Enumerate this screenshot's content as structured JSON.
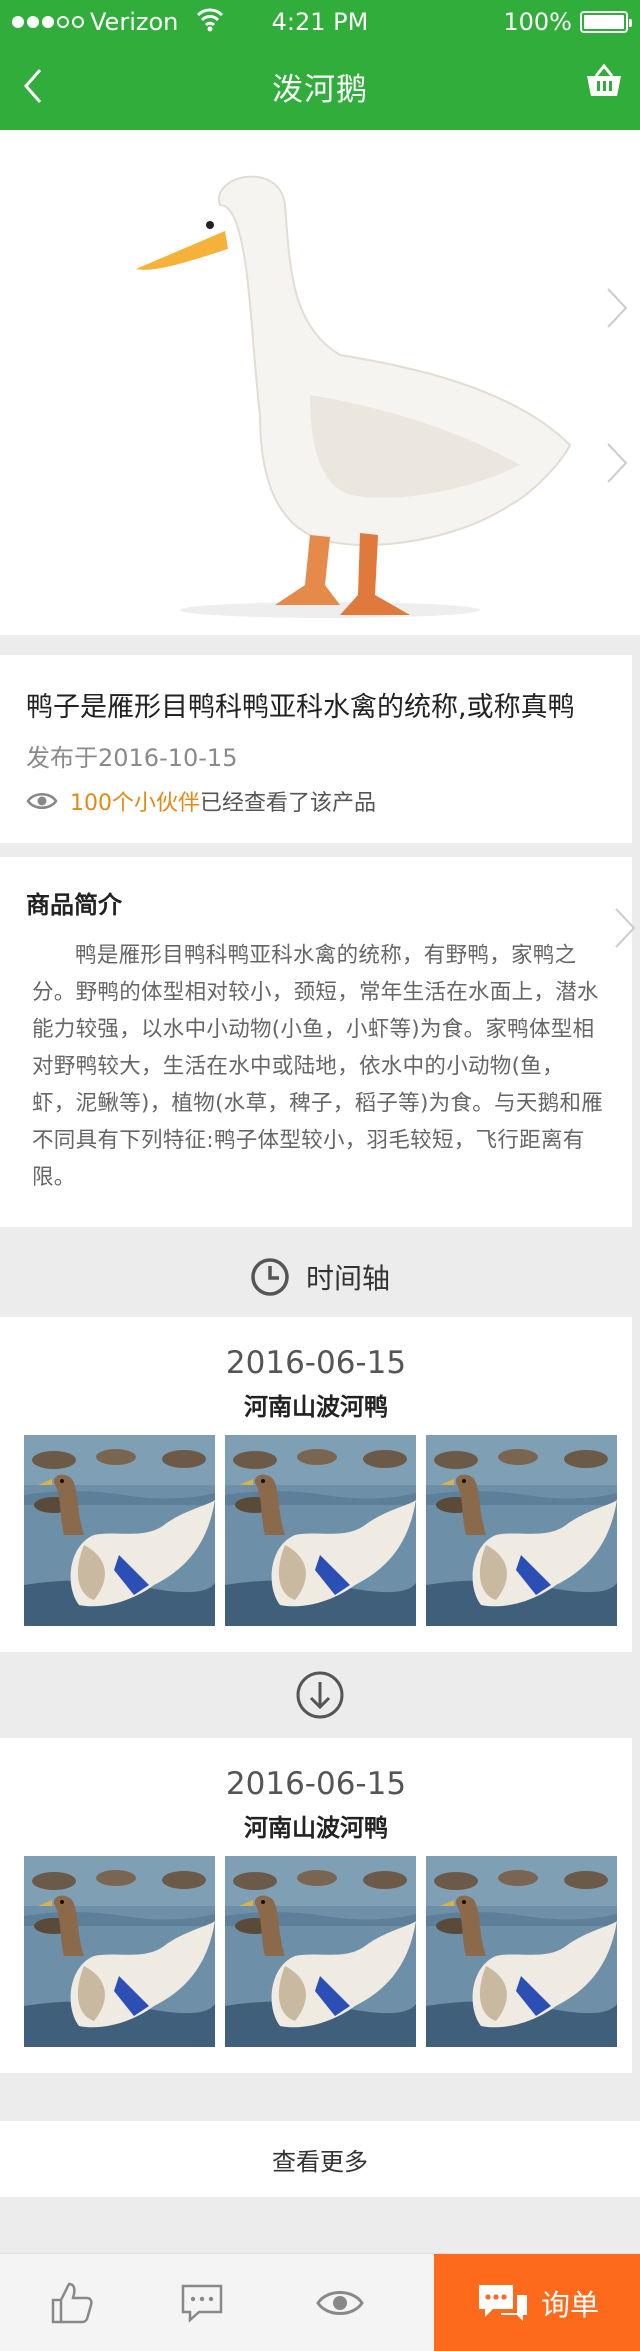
{
  "status_bar": {
    "carrier": "Verizon",
    "time": "4:21 PM",
    "battery": "100%"
  },
  "nav": {
    "title": "泼河鹅",
    "back_icon": "chevron-left-icon",
    "cart_icon": "basket-icon"
  },
  "product": {
    "title": "鸭子是雁形目鸭科鸭亚科水禽的统称,或称真鸭",
    "date": "发布于2016-10-15",
    "views_highlight": "100个小伙伴",
    "views_rest": "已经查看了该产品"
  },
  "intro": {
    "heading": "商品简介",
    "body": "鸭是雁形目鸭科鸭亚科水禽的统称，有野鸭，家鸭之分。野鸭的体型相对较小，颈短，常年生活在水面上，潜水能力较强，以水中小动物(小鱼，小虾等)为食。家鸭体型相对野鸭较大，生活在水中或陆地，依水中的小动物(鱼，虾，泥鳅等)，植物(水草，稗子，稻子等)为食。与天鹅和雁不同具有下列特征:鸭子体型较小，羽毛较短，飞行距离有限。"
  },
  "timeline": {
    "heading": "时间轴",
    "entries": [
      {
        "date": "2016-06-15",
        "place": "河南山波河鸭"
      },
      {
        "date": "2016-06-15",
        "place": "河南山波河鸭"
      }
    ]
  },
  "more_label": "查看更多",
  "tabbar": {
    "inquiry_label": "询单"
  },
  "colors": {
    "brand_green": "#30ad3a",
    "accent_orange": "#fd6a1c",
    "highlight": "#e38a12"
  }
}
